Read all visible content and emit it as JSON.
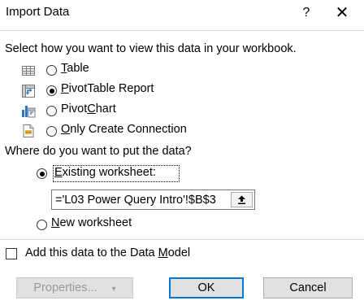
{
  "window": {
    "title": "Import Data",
    "help": "?",
    "close": "✕"
  },
  "view_section": {
    "prompt": "Select how you want to view this data in your workbook.",
    "options": [
      {
        "label": "Table",
        "mnemonic": "T",
        "rest": "able",
        "selected": false,
        "icon": "table-icon"
      },
      {
        "label": "PivotTable Report",
        "mnemonic": "P",
        "rest": "ivotTable Report",
        "selected": true,
        "icon": "pivottable-icon"
      },
      {
        "label": "PivotChart",
        "pre": "Pivot",
        "mnemonic": "C",
        "rest": "hart",
        "selected": false,
        "icon": "pivotchart-icon"
      },
      {
        "label": "Only Create Connection",
        "mnemonic": "O",
        "rest": "nly Create Connection",
        "selected": false,
        "icon": "connection-icon"
      }
    ]
  },
  "location_section": {
    "prompt": "Where do you want to put the data?",
    "existing": {
      "label": "Existing worksheet:",
      "mnemonic": "E",
      "rest": "xisting worksheet:",
      "selected": true
    },
    "reference": "='L03 Power Query Intro'!$B$3",
    "collapse_icon": "collapse-dialog-icon",
    "new": {
      "label": "New worksheet",
      "mnemonic": "N",
      "rest": "ew worksheet",
      "selected": false
    }
  },
  "data_model": {
    "label": "Add this data to the Data Model",
    "checked": false
  },
  "buttons": {
    "properties": "Properties...",
    "ok": "OK",
    "cancel": "Cancel"
  }
}
